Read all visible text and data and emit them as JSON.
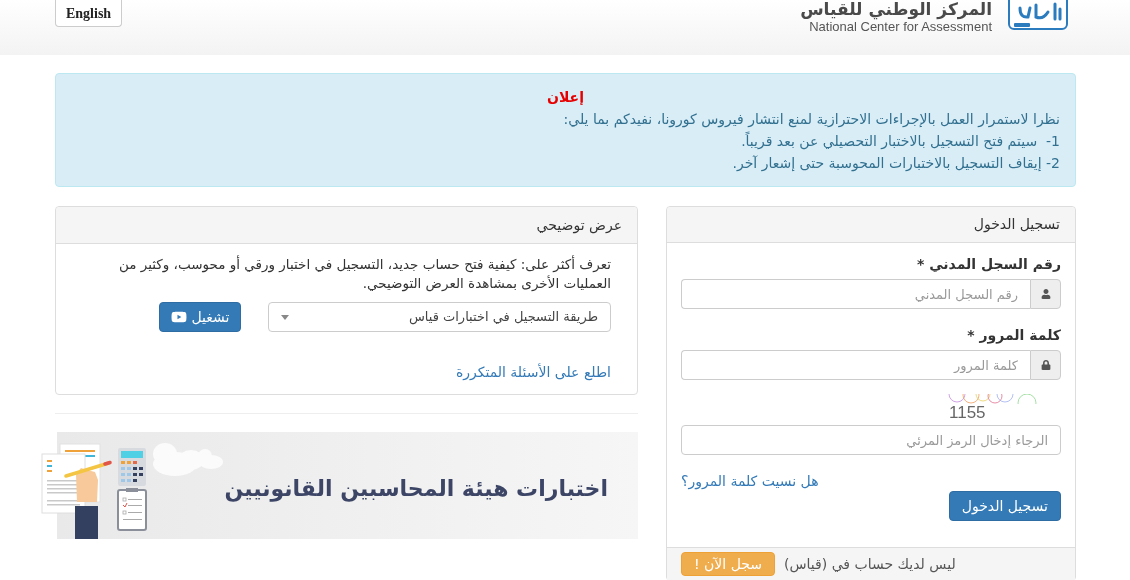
{
  "header": {
    "language_button": "English",
    "logo_title": "المركز الوطني للقياس",
    "logo_subtitle": "National Center for Assessment"
  },
  "announcement": {
    "title": "إعلان",
    "intro": "نظرا لاستمرار العمل بالإجراءات الاحترازية لمنع انتشار فيروس كورونا، نفيدكم بما يلي:",
    "items": [
      "1-  سيتم فتح التسجيل بالاختبار التحصيلي عن بعد قريباً.",
      "2- إيقاف التسجيل بالاختبارات المحوسبة حتى إشعار آخر."
    ]
  },
  "login": {
    "title": "تسجيل الدخول",
    "fields": [
      {
        "kind": "user",
        "label": "رقم السجل المدني *",
        "placeholder": "رقم السجل المدني"
      },
      {
        "kind": "password",
        "label": "كلمة المرور *",
        "placeholder": "كلمة المرور"
      }
    ],
    "captcha": {
      "code": "1155",
      "placeholder": "الرجاء إدخال الرمز المرئي"
    },
    "forgot_link": "هل نسيت كلمة المرور؟",
    "submit_button": "تسجيل الدخول",
    "footer": {
      "text": "ليس لديك حساب في (قياس)",
      "button": "سجل الآن !"
    }
  },
  "demo": {
    "title": "عرض توضيحي",
    "description": "تعرف أكثر على: كيفية فتح حساب جديد، التسجيل في اختبار ورقي أو محوسب، وكثير من العمليات الأخرى بمشاهدة العرض التوضيحي.",
    "select": {
      "value": "طريقة التسجيل في اختبارات قياس"
    },
    "play_button": "تشغيل",
    "faq_link": "اطلع على الأسئلة المتكررة"
  },
  "banner": {
    "heading": "اختبارات هيئة المحاسبين القانونيين"
  }
}
